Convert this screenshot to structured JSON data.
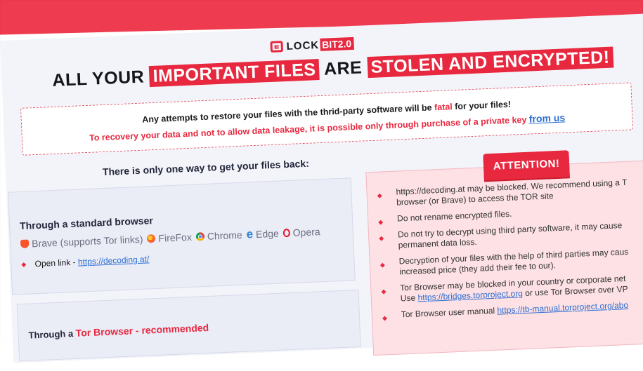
{
  "logo": {
    "prefix": "LOCK",
    "badge": "BIT2.0"
  },
  "headline": {
    "part1": "ALL YOUR",
    "highlight1": "IMPORTANT FILES",
    "part2": "ARE",
    "highlight2": "STOLEN AND ENCRYPTED!"
  },
  "notice": {
    "line1_before": "Any attempts to restore your files with the thrid-party software will be",
    "line1_fatal": "fatal",
    "line1_after": "for your files!",
    "line2": "To recovery your data and not to allow data leakage, it is possible only through purchase of a private key",
    "line2_link": "from us"
  },
  "way_title": "There is only one way to get your files back:",
  "browser_panel": {
    "title": "Through a standard browser",
    "browsers": [
      {
        "icon": "brave-icon",
        "label": "Brave (supports Tor links)"
      },
      {
        "icon": "firefox-icon",
        "label": "FireFox"
      },
      {
        "icon": "chrome-icon",
        "label": "Chrome"
      },
      {
        "icon": "edge-icon",
        "label": "Edge"
      },
      {
        "icon": "opera-icon",
        "label": "Opera"
      }
    ],
    "open_link_label": "Open link -",
    "open_link_url": "https://decoding.at/"
  },
  "tor_panel": {
    "title_prefix": "Through a",
    "title_red": "Tor Browser - recommended"
  },
  "attention": {
    "badge": "ATTENTION!",
    "items": [
      {
        "line1": "https://decoding.at may be blocked. We recommend using a T",
        "line2": "browser (or Brave) to access the TOR site"
      },
      {
        "line1": "Do not rename encrypted files.",
        "line2": ""
      },
      {
        "line1": "Do not try to decrypt using third party software, it may cause",
        "line2": "permanent data loss."
      },
      {
        "line1": "Decryption of your files with the help of third parties may caus",
        "line2": "increased price (they add their fee to our)."
      },
      {
        "line1": "Tor Browser may be blocked in your country or corporate net",
        "line2_before": "Use",
        "line2_link": "https://bridges.torproject.org",
        "line2_after": "or use Tor Browser over VP"
      },
      {
        "line1_before": "Tor Browser user manual",
        "line1_link": "https://tb-manual.torproject.org/abo"
      }
    ]
  },
  "colors": {
    "accent": "#e8283f",
    "link": "#2d6fd2",
    "panel": "#eaecf6",
    "attention_bg": "#fde1e5"
  }
}
